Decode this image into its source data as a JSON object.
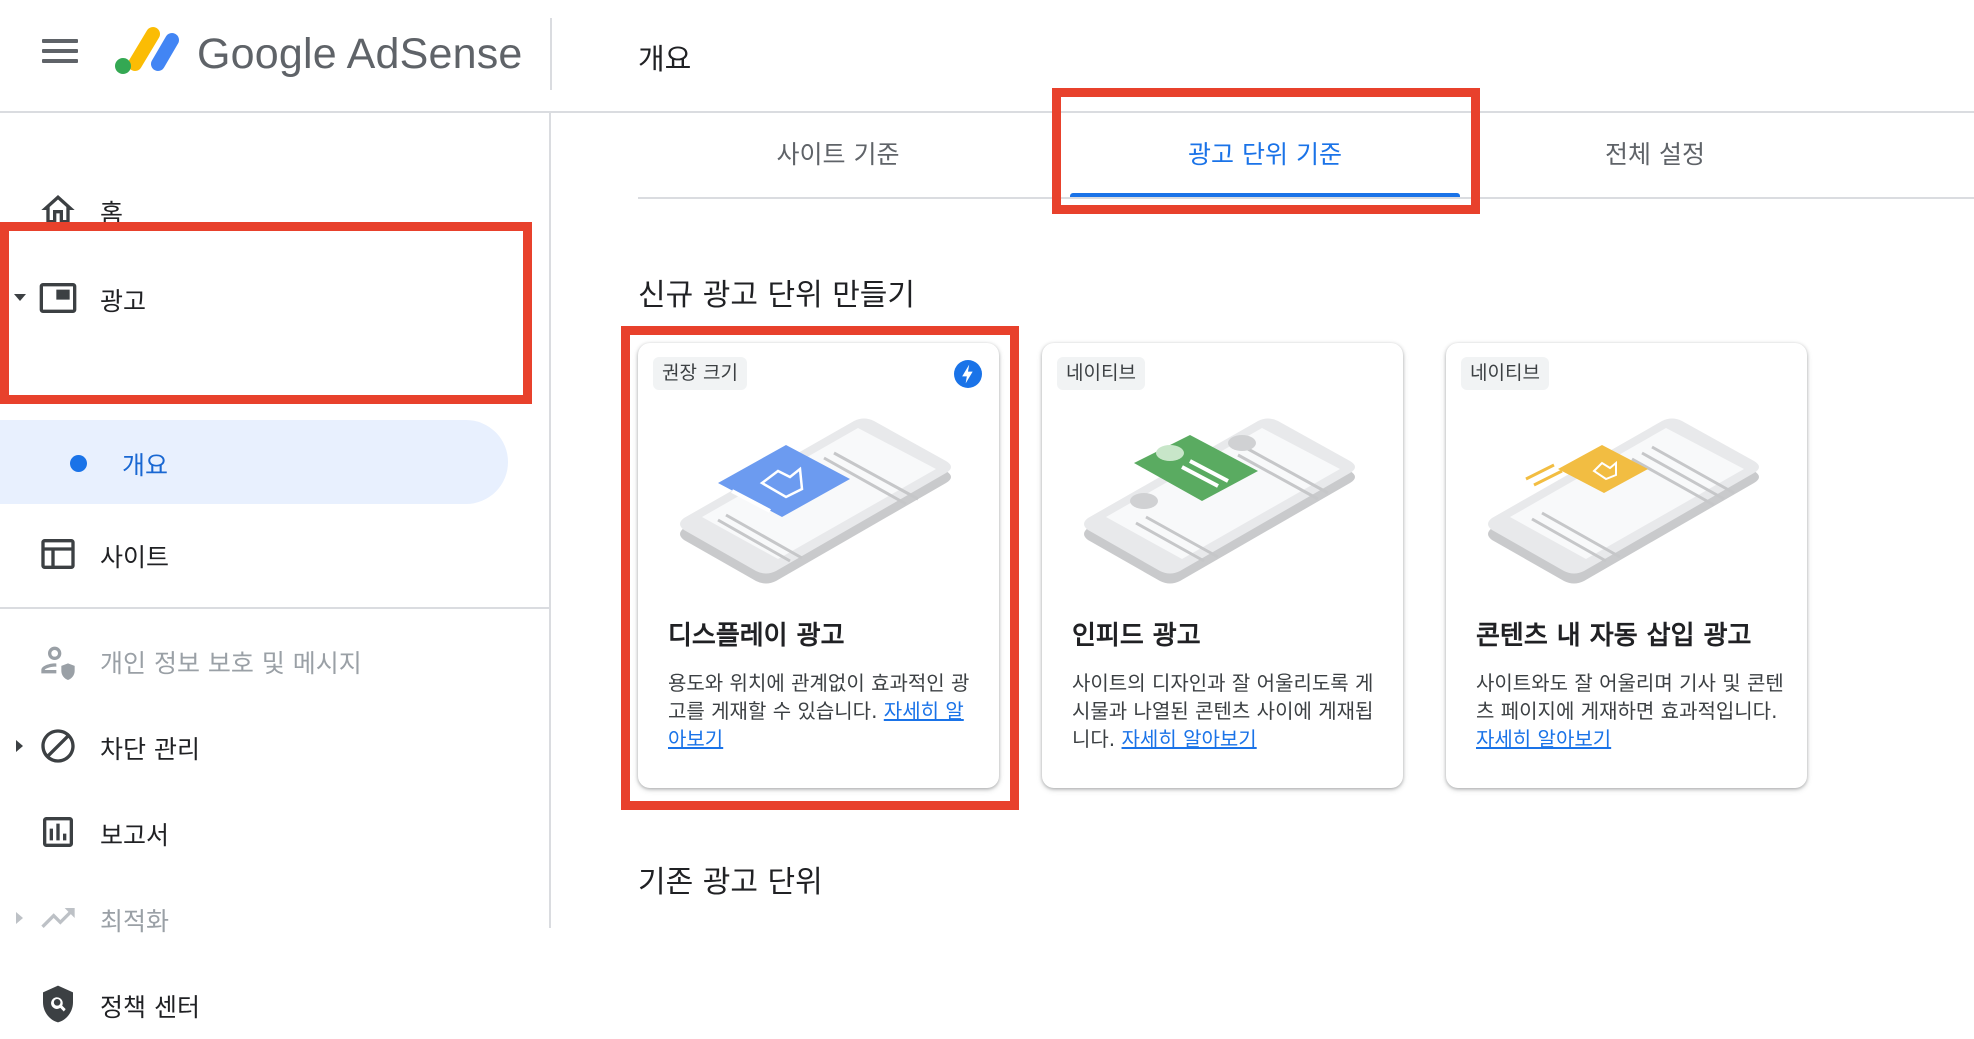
{
  "header": {
    "brand": "Google AdSense",
    "page_title": "개요"
  },
  "sidebar": {
    "items": [
      {
        "label": "홈",
        "icon": "home-icon"
      },
      {
        "label": "광고",
        "icon": "ads-icon"
      },
      {
        "label": "사이트",
        "icon": "sites-icon"
      },
      {
        "label": "개인 정보 보호 및 메시지",
        "icon": "privacy-icon"
      },
      {
        "label": "차단 관리",
        "icon": "block-icon"
      },
      {
        "label": "보고서",
        "icon": "reports-icon"
      },
      {
        "label": "최적화",
        "icon": "optimize-icon"
      },
      {
        "label": "정책 센터",
        "icon": "policy-icon"
      }
    ],
    "sub_item": {
      "label": "개요"
    }
  },
  "tabs": [
    {
      "label": "사이트 기준"
    },
    {
      "label": "광고 단위 기준"
    },
    {
      "label": "전체 설정"
    }
  ],
  "main": {
    "new_section_title": "신규 광고 단위 만들기",
    "existing_section_title": "기존 광고 단위",
    "cards": [
      {
        "chip": "권장 크기",
        "title": "디스플레이 광고",
        "desc": "용도와 위치에 관계없이 효과적인 광고를 게재할 수 있습니다.",
        "link": "자세히 알아보기",
        "accent": "#6c9bf0"
      },
      {
        "chip": "네이티브",
        "title": "인피드 광고",
        "desc": "사이트의 디자인과 잘 어울리도록 게시물과 나열된 콘텐츠 사이에 게재됩니다.",
        "link": "자세히 알아보기",
        "accent": "#5aab61"
      },
      {
        "chip": "네이티브",
        "title": "콘텐츠 내 자동 삽입 광고",
        "desc": "사이트와도 잘 어울리며 기사 및 콘텐츠 페이지에 게재하면 효과적입니다.",
        "link": "자세히 알아보기",
        "accent": "#f2bd42"
      }
    ]
  },
  "colors": {
    "primary": "#1a73e8",
    "highlight": "#e8412c",
    "selected_bg": "#e8f0fe"
  }
}
